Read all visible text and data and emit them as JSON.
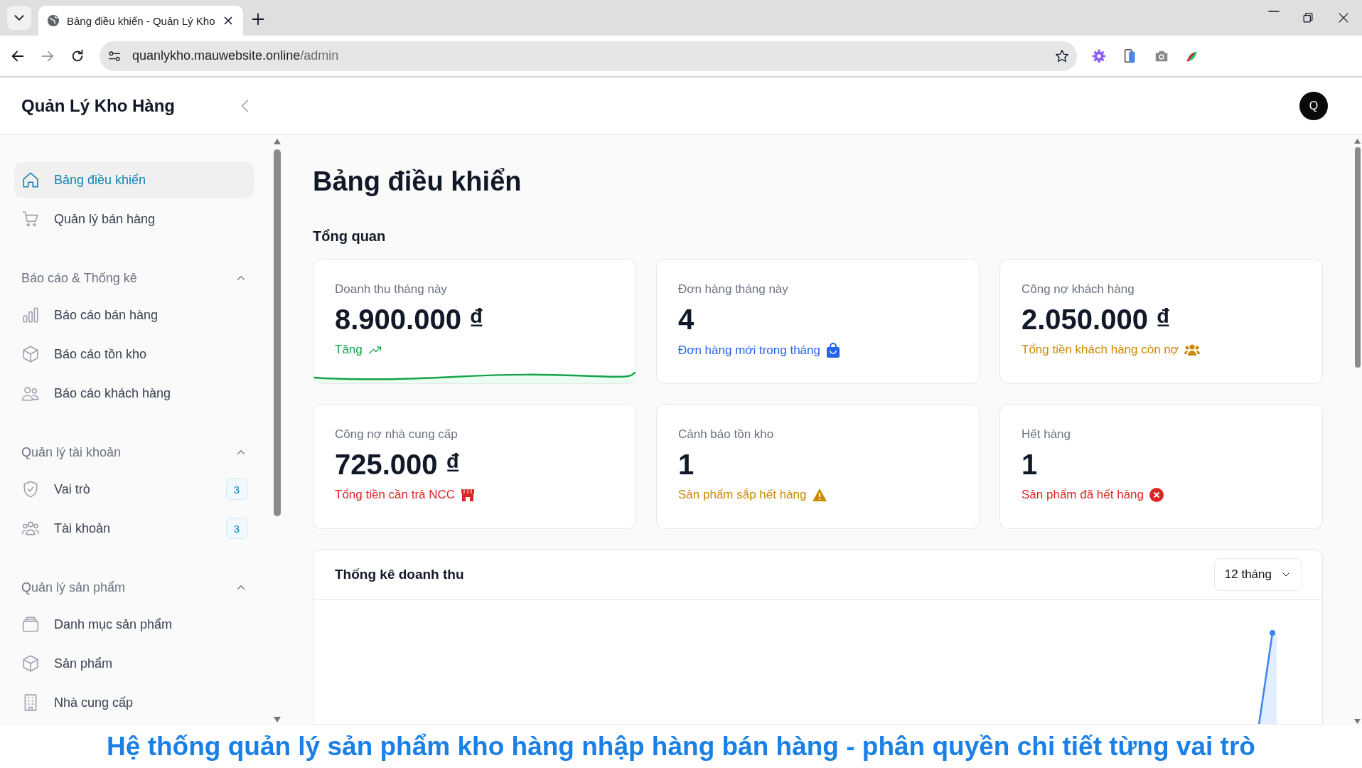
{
  "browser": {
    "tab_title": "Bảng điều khiển - Quản Lý Kho",
    "url_host": "quanlykho.mauwebsite.online",
    "url_path": "/admin"
  },
  "app": {
    "brand": "Quản Lý Kho Hàng",
    "avatar": "Q"
  },
  "sidebar": {
    "items": [
      {
        "kind": "link",
        "label": "Bảng điều khiển",
        "selected": true
      },
      {
        "kind": "link",
        "label": "Quản lý bán hàng",
        "selected": false
      },
      {
        "kind": "group",
        "label": "Báo cáo & Thống kê",
        "expanded": true
      },
      {
        "kind": "link",
        "label": "Báo cáo bán hàng",
        "selected": false
      },
      {
        "kind": "link",
        "label": "Báo cáo tồn kho",
        "selected": false
      },
      {
        "kind": "link",
        "label": "Báo cáo khách hàng",
        "selected": false
      },
      {
        "kind": "group",
        "label": "Quản lý tài khoản",
        "expanded": true
      },
      {
        "kind": "link",
        "label": "Vai trò",
        "badge": "3",
        "selected": false
      },
      {
        "kind": "link",
        "label": "Tài khoản",
        "badge": "3",
        "selected": false
      },
      {
        "kind": "group",
        "label": "Quản lý sản phẩm",
        "expanded": true
      },
      {
        "kind": "link",
        "label": "Danh mục sản phẩm",
        "selected": false
      },
      {
        "kind": "link",
        "label": "Sản phẩm",
        "selected": false
      },
      {
        "kind": "link",
        "label": "Nhà cung cấp",
        "selected": false
      }
    ]
  },
  "page": {
    "title": "Bảng điều khiển",
    "section": "Tổng quan"
  },
  "stats": [
    {
      "kind": "trend",
      "label": "Doanh thu tháng này",
      "value": "8.900.000 ₫",
      "note": "Tăng",
      "color": "#16a34a"
    },
    {
      "kind": "bag",
      "label": "Đơn hàng tháng này",
      "value": "4",
      "note": "Đơn hàng mới trong tháng",
      "color": "#2563eb"
    },
    {
      "kind": "people",
      "label": "Công nợ khách hàng",
      "value": "2.050.000 ₫",
      "note": "Tổng tiền khách hàng còn nợ",
      "color": "#ca8a04"
    },
    {
      "kind": "store",
      "label": "Công nợ nhà cung cấp",
      "value": "725.000 ₫",
      "note": "Tổng tiền cần trả NCC",
      "color": "#dc2626"
    },
    {
      "kind": "warning",
      "label": "Cảnh báo tồn kho",
      "value": "1",
      "note": "Sản phẩm sắp hết hàng",
      "color": "#ca8a04"
    },
    {
      "kind": "error",
      "label": "Hết hàng",
      "value": "1",
      "note": "Sản phẩm đã hết hàng",
      "color": "#dc2626"
    }
  ],
  "revenue": {
    "title": "Thống kê doanh thu",
    "period": "12 tháng"
  },
  "caption": "Hệ thống quản lý sản phẩm kho hàng nhập hàng bán hàng - phân quyền chi tiết từng vai trò"
}
